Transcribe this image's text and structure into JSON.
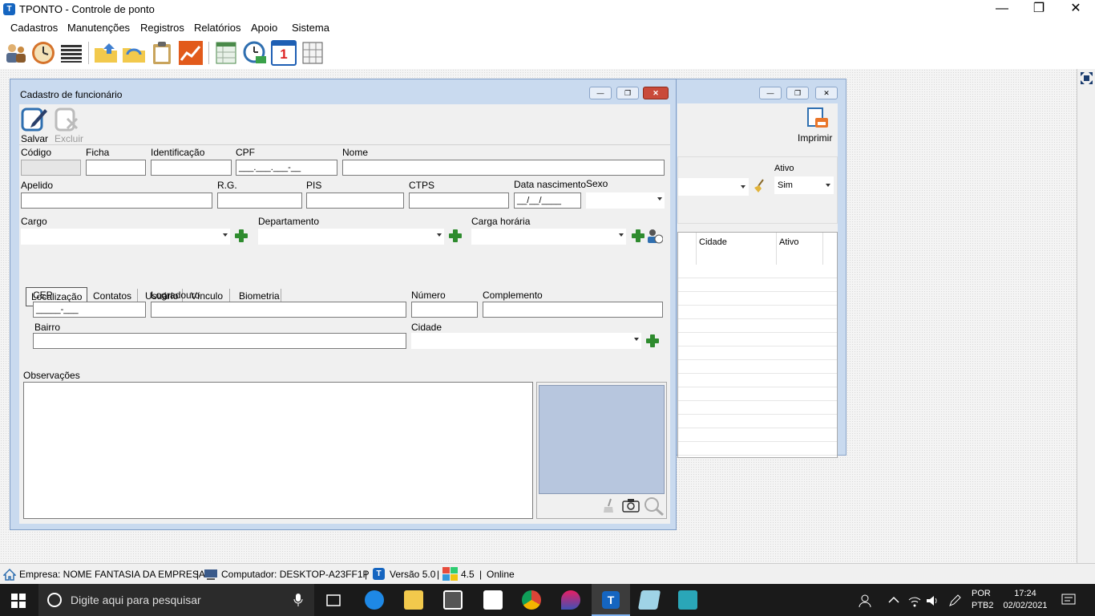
{
  "app": {
    "icon_text": "T",
    "title": "TPONTO - Controle de ponto"
  },
  "window_controls": {
    "minimize": "—",
    "restore": "❐",
    "close": "✕"
  },
  "menu": [
    "Cadastros",
    "Manutenções",
    "Registros",
    "Relatórios",
    "Apoio",
    "Sistema"
  ],
  "toolbar_icons": [
    "employees-icon",
    "clock-icon",
    "list-icon",
    "folder-up-icon",
    "folder-refresh-icon",
    "clipboard-icon",
    "chart-icon",
    "spreadsheet-icon",
    "clock-check-icon",
    "calendar-one-icon",
    "calculator-grid-icon"
  ],
  "toolbar_calendar_text": "1",
  "bg_window": {
    "print_label": "Imprimir",
    "ativo_label": "Ativo",
    "ativo_value": "Sim",
    "columns": [
      "Cidade",
      "Ativo"
    ]
  },
  "form": {
    "title": "Cadastro de funcionário",
    "save_label": "Salvar",
    "delete_label": "Excluir",
    "labels": {
      "codigo": "Código",
      "ficha": "Ficha",
      "identificacao": "Identificação",
      "cpf": "CPF",
      "nome": "Nome",
      "apelido": "Apelido",
      "rg": "R.G.",
      "pis": "PIS",
      "ctps": "CTPS",
      "nascimento": "Data nascimento",
      "sexo": "Sexo",
      "cargo": "Cargo",
      "departamento": "Departamento",
      "carga": "Carga horária"
    },
    "values": {
      "cpf_mask": "___.___.___-__",
      "nascimento_mask": "__/__/____"
    },
    "tabs": [
      "Localização",
      "Contatos",
      "Usuário",
      "Vínculo",
      "Biometria"
    ],
    "location": {
      "cep": "CEP",
      "cep_mask": "_____-___",
      "logradouro": "Logradouro",
      "numero": "Número",
      "complemento": "Complemento",
      "bairro": "Bairro",
      "cidade": "Cidade"
    },
    "observacoes": "Observações"
  },
  "status": {
    "empresa": "Empresa: NOME FANTASIA DA EMPRESA",
    "computador": "Computador: DESKTOP-A23FF1P",
    "versao": "Versão 5.0",
    "build": "4.5",
    "online": "Online",
    "sep": "|"
  },
  "taskbar": {
    "search_placeholder": "Digite aqui para pesquisar",
    "lang1": "POR",
    "lang2": "PTB2",
    "time": "17:24",
    "date": "02/02/2021"
  }
}
